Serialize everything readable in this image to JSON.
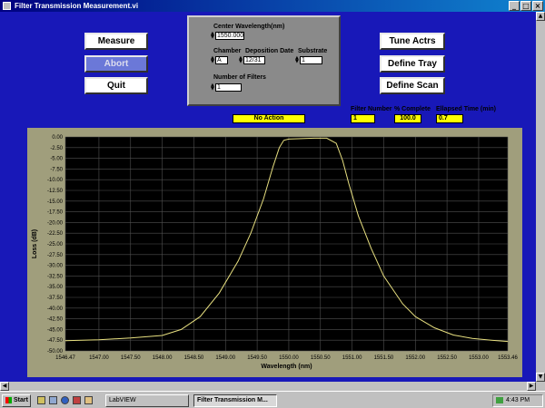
{
  "window": {
    "title": "Filter Transmission Measurement.vi"
  },
  "buttons": {
    "measure": "Measure",
    "abort": "Abort",
    "quit": "Quit",
    "tune": "Tune Actrs",
    "define_tray": "Define Tray",
    "define_scan": "Define Scan"
  },
  "params": {
    "center_wavelength_label": "Center Wavelength(nm)",
    "center_wavelength_value": "1550.000",
    "chamber_label": "Chamber",
    "chamber_value": "A",
    "deposition_date_label": "Deposition Date",
    "deposition_date_value": "12/31",
    "substrate_label": "Substrate",
    "substrate_value": "1",
    "num_filters_label": "Number of Filters",
    "num_filters_value": "1"
  },
  "status": {
    "action": "No Action",
    "filter_number_label": "Filter Number",
    "filter_number_value": "1",
    "percent_complete_label": "% Complete",
    "percent_complete_value": "100.0",
    "elapsed_label": "Ellapsed Time (min)",
    "elapsed_value": "0.7"
  },
  "taskbar": {
    "start": "Start",
    "tasks": [
      "LabVIEW",
      "Filter Transmission M..."
    ],
    "clock": "4:43 PM"
  },
  "chart_data": {
    "type": "line",
    "title": "",
    "xlabel": "Wavelength (nm)",
    "ylabel": "Loss (dB)",
    "xlim": [
      1546.47,
      1553.46
    ],
    "ylim": [
      -50,
      0
    ],
    "grid": true,
    "x_ticks": [
      "1546.47",
      "1547.00",
      "1547.50",
      "1548.00",
      "1548.50",
      "1549.00",
      "1549.50",
      "1550.00",
      "1550.50",
      "1551.00",
      "1551.50",
      "1552.00",
      "1552.50",
      "1553.00",
      "1553.46"
    ],
    "y_ticks": [
      "0.00",
      "-2.50",
      "-5.00",
      "-7.50",
      "-10.00",
      "-12.50",
      "-15.00",
      "-17.50",
      "-20.00",
      "-22.50",
      "-25.00",
      "-27.50",
      "-30.00",
      "-32.50",
      "-35.00",
      "-37.50",
      "-40.00",
      "-42.50",
      "-45.00",
      "-47.50",
      "-50.00"
    ],
    "series": [
      {
        "color": "#e8e080",
        "x": [
          1546.47,
          1547.0,
          1547.5,
          1548.0,
          1548.3,
          1548.6,
          1548.9,
          1549.2,
          1549.4,
          1549.6,
          1549.75,
          1549.85,
          1549.92,
          1550.0,
          1550.2,
          1550.4,
          1550.6,
          1550.75,
          1550.85,
          1550.95,
          1551.1,
          1551.3,
          1551.5,
          1551.8,
          1552.0,
          1552.3,
          1552.6,
          1552.9,
          1553.2,
          1553.46
        ],
        "y": [
          -47.6,
          -47.4,
          -47.0,
          -46.4,
          -45.0,
          -42.0,
          -36.5,
          -29.0,
          -22.5,
          -14.5,
          -7.0,
          -2.5,
          -0.8,
          -0.5,
          -0.4,
          -0.3,
          -0.3,
          -1.5,
          -5.5,
          -11.0,
          -18.5,
          -26.0,
          -32.5,
          -39.0,
          -42.0,
          -44.6,
          -46.3,
          -47.1,
          -47.5,
          -47.8
        ]
      }
    ]
  }
}
